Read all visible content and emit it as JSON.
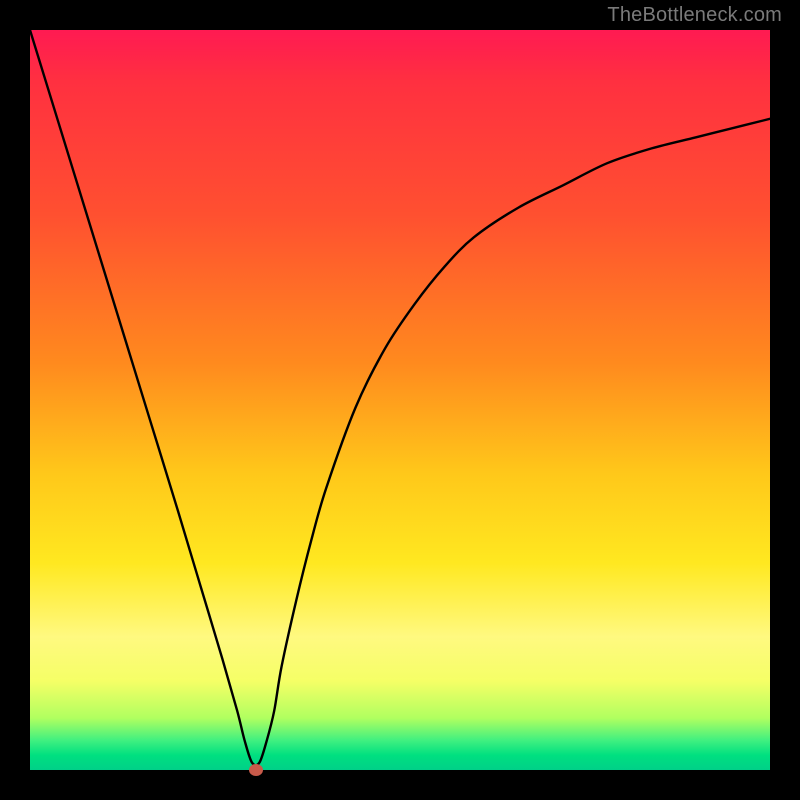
{
  "watermark": "TheBottleneck.com",
  "chart_data": {
    "type": "line",
    "title": "",
    "xlabel": "",
    "ylabel": "",
    "xlim": [
      0,
      100
    ],
    "ylim": [
      0,
      100
    ],
    "grid": false,
    "x": [
      0,
      4,
      8,
      12,
      16,
      20,
      23,
      26,
      28,
      29,
      30,
      31,
      32,
      33,
      34,
      36,
      38,
      40,
      44,
      48,
      52,
      56,
      60,
      66,
      72,
      78,
      84,
      90,
      96,
      100
    ],
    "values": [
      100,
      87,
      74,
      61,
      48,
      35,
      25,
      15,
      8,
      4,
      1,
      1,
      4,
      8,
      14,
      23,
      31,
      38,
      49,
      57,
      63,
      68,
      72,
      76,
      79,
      82,
      84,
      85.5,
      87,
      88
    ],
    "marker": {
      "x": 30.5,
      "y": 0
    },
    "line_color": "#000000",
    "background": "gradient-red-yellow-green"
  }
}
